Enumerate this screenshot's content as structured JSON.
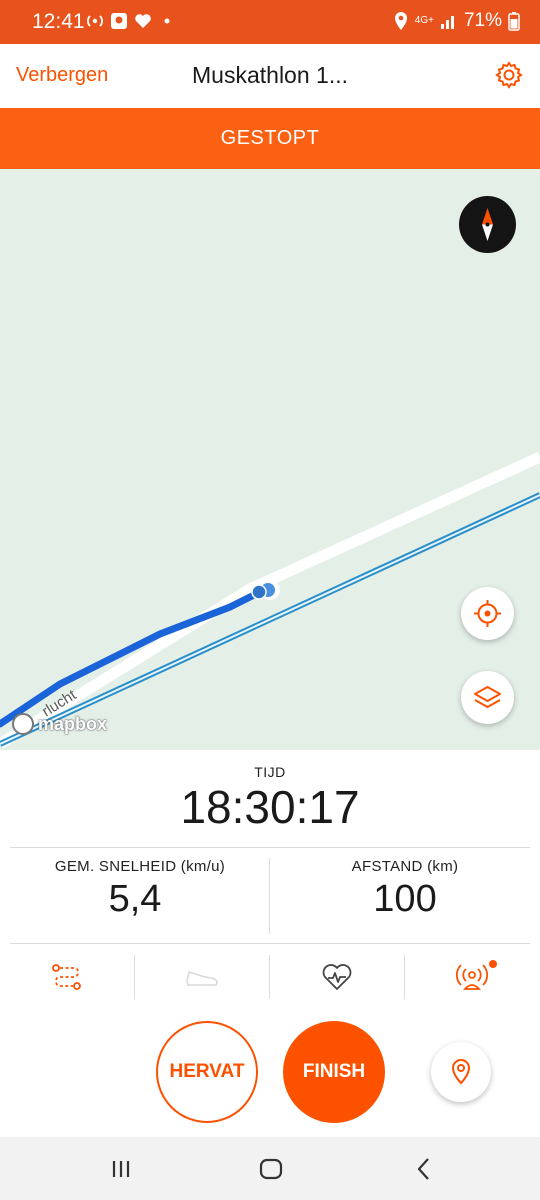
{
  "status_bar": {
    "time": "12:41",
    "battery": "71%",
    "network": "4G+",
    "icons": [
      "hotspot-icon",
      "app-notification-icon",
      "heart-icon",
      "dot-icon",
      "location-icon",
      "signal-icon",
      "battery-icon"
    ]
  },
  "header": {
    "hide_label": "Verbergen",
    "title": "Muskathlon 1...",
    "settings_icon": "gear-icon"
  },
  "banner": {
    "label": "GESTOPT"
  },
  "map": {
    "attribution": "mapbox",
    "street_label": "rlucht",
    "buttons": [
      "compass-icon",
      "locate-icon",
      "layers-icon"
    ]
  },
  "stats": {
    "time_label": "TIJD",
    "time_value": "18:30:17",
    "speed_label": "GEM. SNELHEID (km/u)",
    "speed_value": "5,4",
    "distance_label": "AFSTAND (km)",
    "distance_value": "100"
  },
  "tools": [
    "route-icon",
    "shoe-icon",
    "heart-rate-icon",
    "beacon-icon"
  ],
  "actions": {
    "resume_label": "HERVAT",
    "finish_label": "FINISH",
    "pin_icon": "map-pin-icon"
  },
  "nav": [
    "recents-icon",
    "home-icon",
    "back-icon"
  ],
  "colors": {
    "accent": "#fc5200",
    "banner": "#fc6113",
    "status_bar": "#e8531d",
    "map_bg": "#e4efe8",
    "route": "#1a63d8"
  }
}
